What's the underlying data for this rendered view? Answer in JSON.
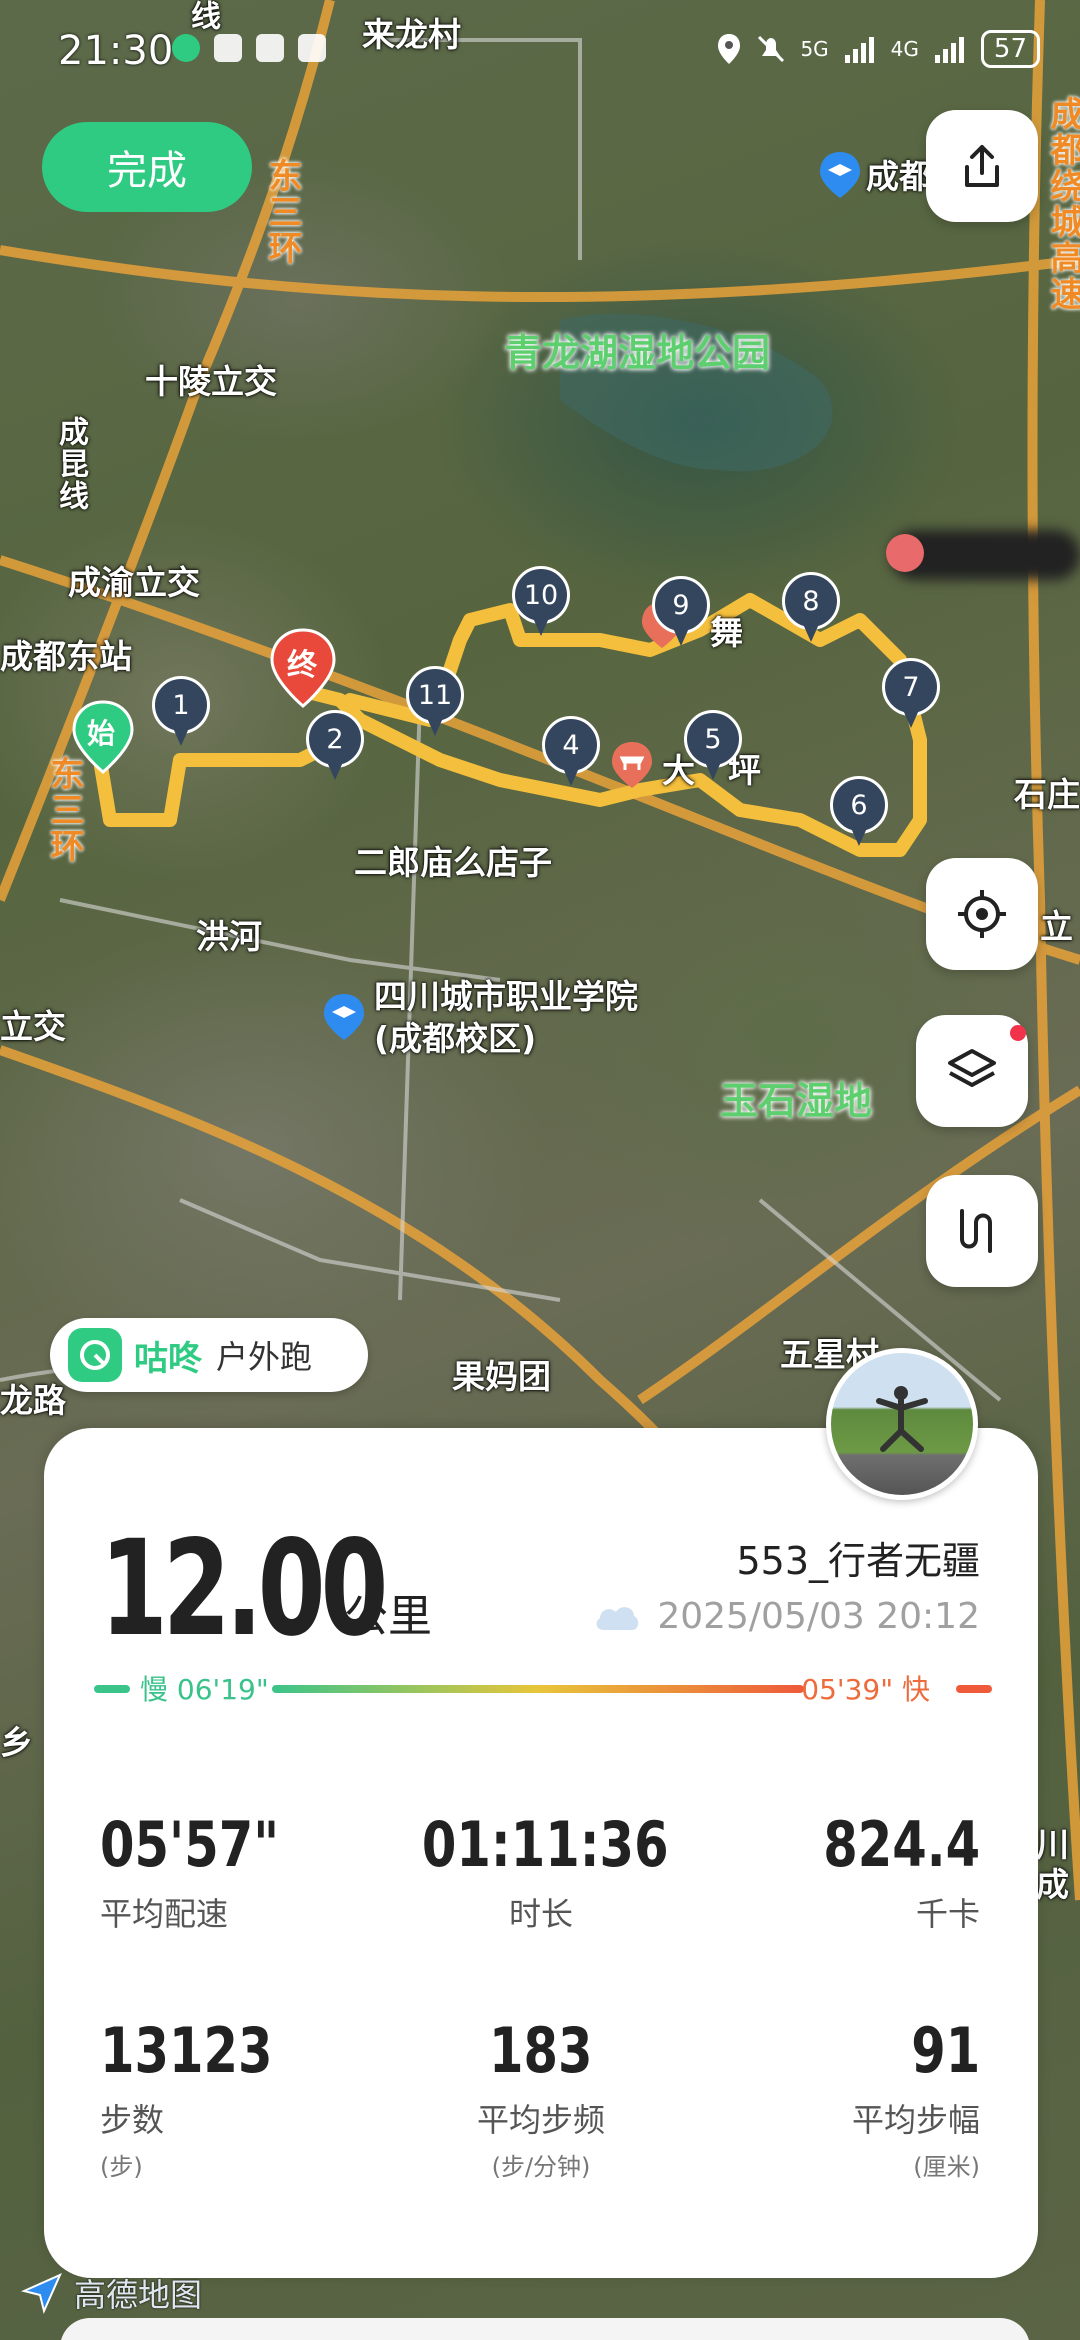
{
  "status_bar": {
    "time": "21:30",
    "network_1": "5G",
    "network_2": "4G",
    "battery": "57"
  },
  "map": {
    "labels": {
      "lailongcun": "来龙村",
      "shilingli": "十陵立交",
      "qinglonghu": "青龙湖湿地公园",
      "chengyu": "成渝立交",
      "chengdudongzhan": "成都东站",
      "erlangmiao": "二郎庙么店子",
      "honghe": "洪河",
      "sichuan_college": "四川城市职业学院(成都校区)",
      "yushi": "玉石湿地",
      "guomatuan": "果妈团",
      "wuxing": "五星村",
      "shizhuang": "石庄",
      "lijiao": "立交",
      "longlu": "龙路",
      "xiang": "乡",
      "li": "立",
      "chuan": "川",
      "cheng": "成",
      "dongsanhuan_1": "东三环",
      "dongsanhuan_2": "东三环",
      "chengkun": "成昆线",
      "raocheng": "成都绕城高速",
      "chengdu_school": "成都",
      "dayanping": "大",
      "ping": "坪",
      "cunxian": "线",
      "shiwu": "舞"
    },
    "start_label": "始",
    "end_label": "终",
    "pins": [
      "1",
      "2",
      "4",
      "5",
      "6",
      "7",
      "8",
      "9",
      "10",
      "11"
    ],
    "route_color": "#f4bf3c"
  },
  "buttons": {
    "done": "完成"
  },
  "brand": {
    "name": "咕咚",
    "activity": "户外跑"
  },
  "stats": {
    "distance": "12.00",
    "distance_unit": "公里",
    "username": "553_行者无疆",
    "datetime": "2025/05/03 20:12",
    "pace_slow": "慢 06'19\"",
    "pace_fast": "05'39\" 快",
    "avg_pace": {
      "value": "05'57\"",
      "label": "平均配速"
    },
    "duration": {
      "value": "01:11:36",
      "label": "时长"
    },
    "calories": {
      "value": "824.4",
      "label": "千卡"
    },
    "steps": {
      "value": "13123",
      "label": "步数",
      "unit": "(步)"
    },
    "cadence": {
      "value": "183",
      "label": "平均步频",
      "unit": "(步/分钟)"
    },
    "stride": {
      "value": "91",
      "label": "平均步幅",
      "unit": "(厘米)"
    }
  },
  "footer": {
    "amap": "高德地图"
  }
}
